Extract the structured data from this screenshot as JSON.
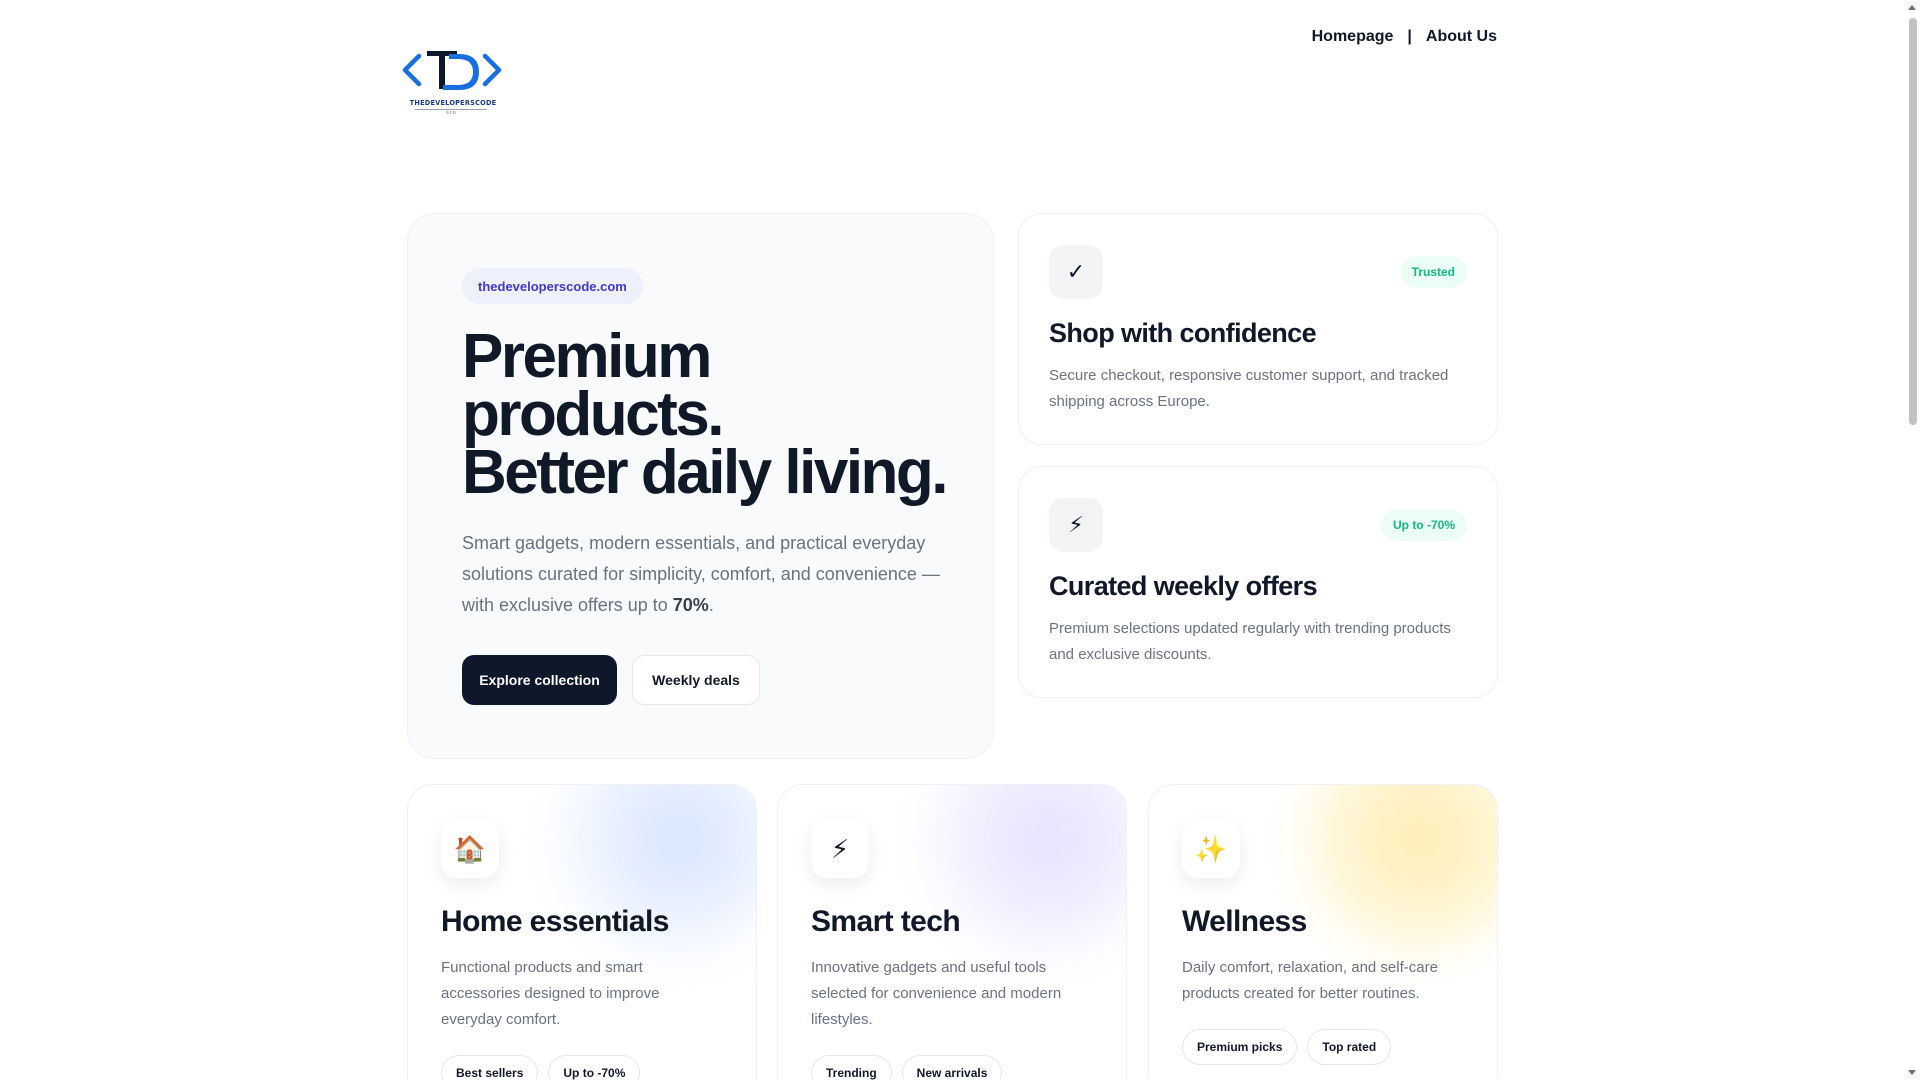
{
  "header": {
    "logo": {
      "wordmark": "THEDEVELOPERSCODE",
      "tagline": "s.r.o",
      "colors": {
        "brackets": "#1a6fe0",
        "letters": "#0f172a"
      }
    },
    "nav": {
      "homepage": "Homepage",
      "separator": "|",
      "about": "About Us"
    }
  },
  "hero": {
    "domain_badge": "thedeveloperscode.com",
    "title_line1": "Premium",
    "title_line2": "products.",
    "title_line3": "Better daily living.",
    "description": "Smart gadgets, modern essentials, and practical everyday solutions curated for simplicity, comfort, and convenience — with exclusive offers up to ",
    "description_highlight": "70%",
    "description_end": ".",
    "primary_button": "Explore collection",
    "secondary_button": "Weekly deals"
  },
  "features": [
    {
      "icon": "checkmark-icon",
      "icon_glyph": "✓",
      "badge": "Trusted",
      "title": "Shop with confidence",
      "description": "Secure checkout, responsive customer support, and tracked shipping across Europe."
    },
    {
      "icon": "lightning-icon",
      "icon_glyph": "⚡",
      "badge": "Up to -70%",
      "title": "Curated weekly offers",
      "description": "Premium selections updated regularly with trending products and exclusive discounts."
    }
  ],
  "categories": [
    {
      "icon": "house-icon",
      "icon_glyph": "🏠",
      "title": "Home essentials",
      "description": "Functional products and smart accessories designed to improve everyday comfort.",
      "tags": [
        "Best sellers",
        "Up to -70%"
      ]
    },
    {
      "icon": "lightning-icon",
      "icon_glyph": "⚡",
      "title": "Smart tech",
      "description": "Innovative gadgets and useful tools selected for convenience and modern lifestyles.",
      "tags": [
        "Trending",
        "New arrivals"
      ]
    },
    {
      "icon": "sparkles-icon",
      "icon_glyph": "✨",
      "title": "Wellness",
      "description": "Daily comfort, relaxation, and self-care products created for better routines.",
      "tags": [
        "Premium picks",
        "Top rated"
      ]
    }
  ],
  "colors": {
    "accent_dark": "#0f172a",
    "badge_green": "#10b981",
    "domain_badge_text": "#4338ca"
  }
}
